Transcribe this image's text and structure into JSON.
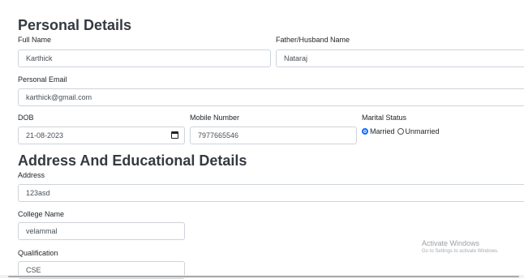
{
  "personal": {
    "heading": "Personal Details",
    "full_name": {
      "label": "Full Name",
      "value": "Karthick"
    },
    "father_name": {
      "label": "Father/Husband Name",
      "value": "Nataraj"
    },
    "email": {
      "label": "Personal Email",
      "value": "karthick@gmail.com"
    },
    "dob": {
      "label": "DOB",
      "value": "21-08-2023"
    },
    "mobile": {
      "label": "Mobile Number",
      "value": "7977665546"
    },
    "marital": {
      "label": "Marital Status",
      "options": [
        "Married",
        "Unmarried"
      ],
      "selected": "Married"
    }
  },
  "address": {
    "heading": "Address And Educational Details",
    "address": {
      "label": "Address",
      "value": "123asd"
    },
    "college": {
      "label": "College Name",
      "value": "velammal"
    },
    "qualification": {
      "label": "Qualification",
      "value": "CSE"
    }
  },
  "watermark": {
    "line1": "Activate Windows",
    "line2": "Go to Settings to activate Windows."
  },
  "colors": {
    "accent": "#0d6efd",
    "border": "#ced4da",
    "heading": "#343a40"
  }
}
